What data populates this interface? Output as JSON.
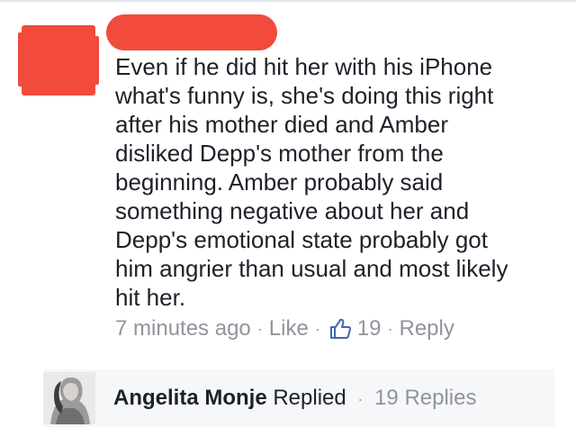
{
  "comment": {
    "lines": [
      "Even if he did hit her with his iPhone",
      "what's funny is, she's doing this right",
      "after his mother died and Amber",
      "disliked Depp's mother from the",
      "beginning. Amber probably said",
      "something negative about her and",
      "Depp's emotional state  probably got",
      "him angrier than usual and most likely",
      "hit her."
    ]
  },
  "meta": {
    "time": "7 minutes ago",
    "like_label": "Like",
    "like_icon": "thumbs-up-icon",
    "like_count": "19",
    "reply_label": "Reply",
    "separator": "·"
  },
  "replies": {
    "name": "Angelita Monje",
    "action": "Replied",
    "count": "19 Replies"
  },
  "colors": {
    "redaction": "#f24a3c",
    "text": "#1d2129",
    "meta_gray": "#90949c",
    "link_blue": "#4267b2",
    "reply_bg": "#f6f7f9"
  }
}
